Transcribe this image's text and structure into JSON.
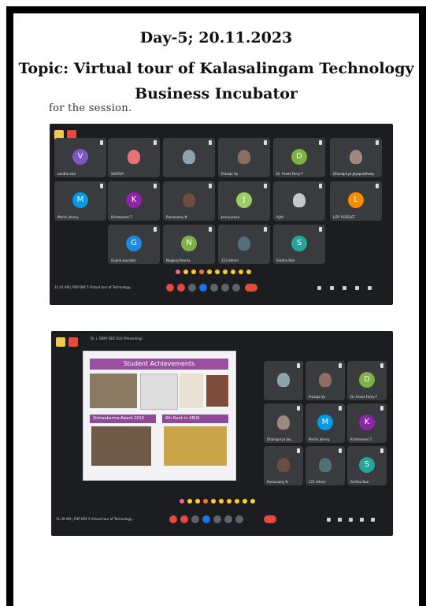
{
  "document": {
    "title_line1": "Day-5; 20.11.2023",
    "title_line2": "Topic: Virtual tour of Kalasalingam Technology",
    "title_line3": "Business Incubator",
    "cutoff_text": "for the session."
  },
  "screenshot1": {
    "participants": [
      {
        "name": "sasitha sasi",
        "initial": "V",
        "color": "#7e57c2"
      },
      {
        "name": "SASTHA",
        "initial": "",
        "color": "#e57373"
      },
      {
        "name": "",
        "initial": "",
        "color": "#90a4ae"
      },
      {
        "name": "Prasaja Vp",
        "initial": "",
        "color": "#8d6e63"
      },
      {
        "name": "Dr. Fenes Femy F",
        "initial": "D",
        "color": "#7cb342"
      },
      {
        "name": "Dhanapriya Jayapradheep",
        "initial": "",
        "color": "#a1887f"
      },
      {
        "name": "Merlin Johnsy",
        "initial": "M",
        "color": "#039be5"
      },
      {
        "name": "Krishnaveni T",
        "initial": "K",
        "color": "#8e24aa"
      },
      {
        "name": "Ramasamy N",
        "initial": "",
        "color": "#6d4c41"
      },
      {
        "name": "Jeeva Jeeva",
        "initial": "J",
        "color": "#9ccc65"
      },
      {
        "name": "Ajith",
        "initial": "",
        "color": "#c8c8c8"
      },
      {
        "name": "LIZY ROSELET",
        "initial": "L",
        "color": "#fb8c00"
      },
      {
        "name": "Gnana soundari",
        "initial": "G",
        "color": "#1e88e5"
      },
      {
        "name": "Nagaraj Poorna",
        "initial": "N",
        "color": "#7cb342"
      },
      {
        "name": "123 others",
        "initial": "",
        "color": "#546e7a"
      },
      {
        "name": "Smitha Nair",
        "initial": "S",
        "color": "#26a69a"
      }
    ],
    "bottom_bar_text": "11:41 AM  |  FDP DAY 5 Virtual tour of Technology..."
  },
  "screenshot2": {
    "presenter_label": "Dr. J. DENY BDC KLU (Presenting)",
    "slide": {
      "title": "Student Achievements",
      "band_left": "Vishwakarma-Award 2019",
      "band_right": "6th Rank in ARIIA"
    },
    "participants": [
      {
        "name": "",
        "initial": "",
        "color": "#90a4ae"
      },
      {
        "name": "Prasaja Vp",
        "initial": "",
        "color": "#8d6e63"
      },
      {
        "name": "Dr. Fenes Femy F",
        "initial": "D",
        "color": "#7cb342"
      },
      {
        "name": "Dhanapriya Jay...",
        "initial": "",
        "color": "#a1887f"
      },
      {
        "name": "Merlin Johnsy",
        "initial": "M",
        "color": "#039be5"
      },
      {
        "name": "Krishnaveni T",
        "initial": "K",
        "color": "#8e24aa"
      },
      {
        "name": "Ramasamy N",
        "initial": "",
        "color": "#6d4c41"
      },
      {
        "name": "121 others",
        "initial": "",
        "color": "#546e7a"
      },
      {
        "name": "Smitha Nair",
        "initial": "S",
        "color": "#26a69a"
      }
    ],
    "bottom_bar_text": "11:39 AM  |  FDP DAY 5 Virtual tour of Technology..."
  },
  "colors": {
    "meet_background": "#1c1d20",
    "tile_background": "#3a3b3e",
    "hangup_red": "#e64a3b",
    "slide_accent": "#9a4fa0"
  }
}
